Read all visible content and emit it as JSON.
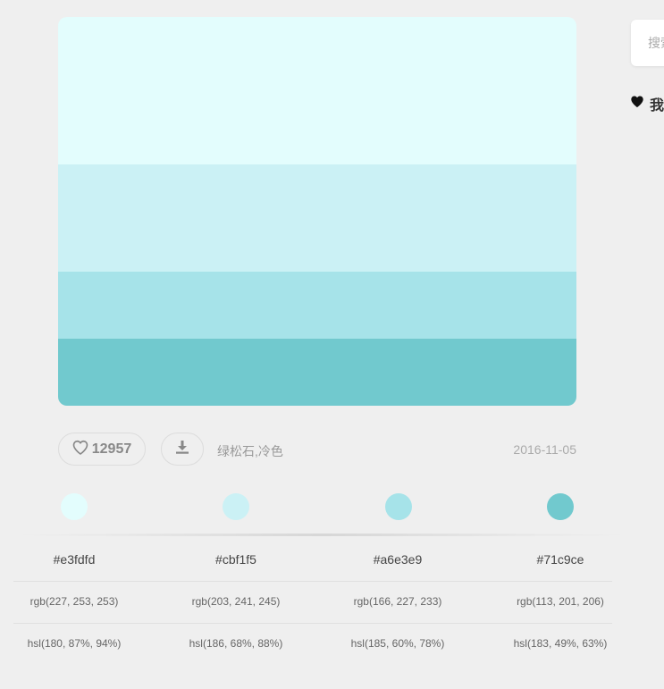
{
  "palette": {
    "colors": [
      "#e3fdfd",
      "#cbf1f5",
      "#a6e3e9",
      "#71c9ce"
    ],
    "hex": [
      "#e3fdfd",
      "#cbf1f5",
      "#a6e3e9",
      "#71c9ce"
    ],
    "rgb": [
      "rgb(227, 253, 253)",
      "rgb(203, 241, 245)",
      "rgb(166, 227, 233)",
      "rgb(113, 201, 206)"
    ],
    "hsl": [
      "hsl(180, 87%, 94%)",
      "hsl(186, 68%, 88%)",
      "hsl(185, 60%, 78%)",
      "hsl(183, 49%, 63%)"
    ]
  },
  "actions": {
    "likes": "12957",
    "tags": "绿松石,冷色",
    "date": "2016-11-05",
    "like_icon": "heart-outline-icon",
    "download_icon": "download-icon"
  },
  "sidebar": {
    "search_placeholder": "搜索",
    "favorites_label": "我",
    "favorites_icon": "heart-icon"
  }
}
